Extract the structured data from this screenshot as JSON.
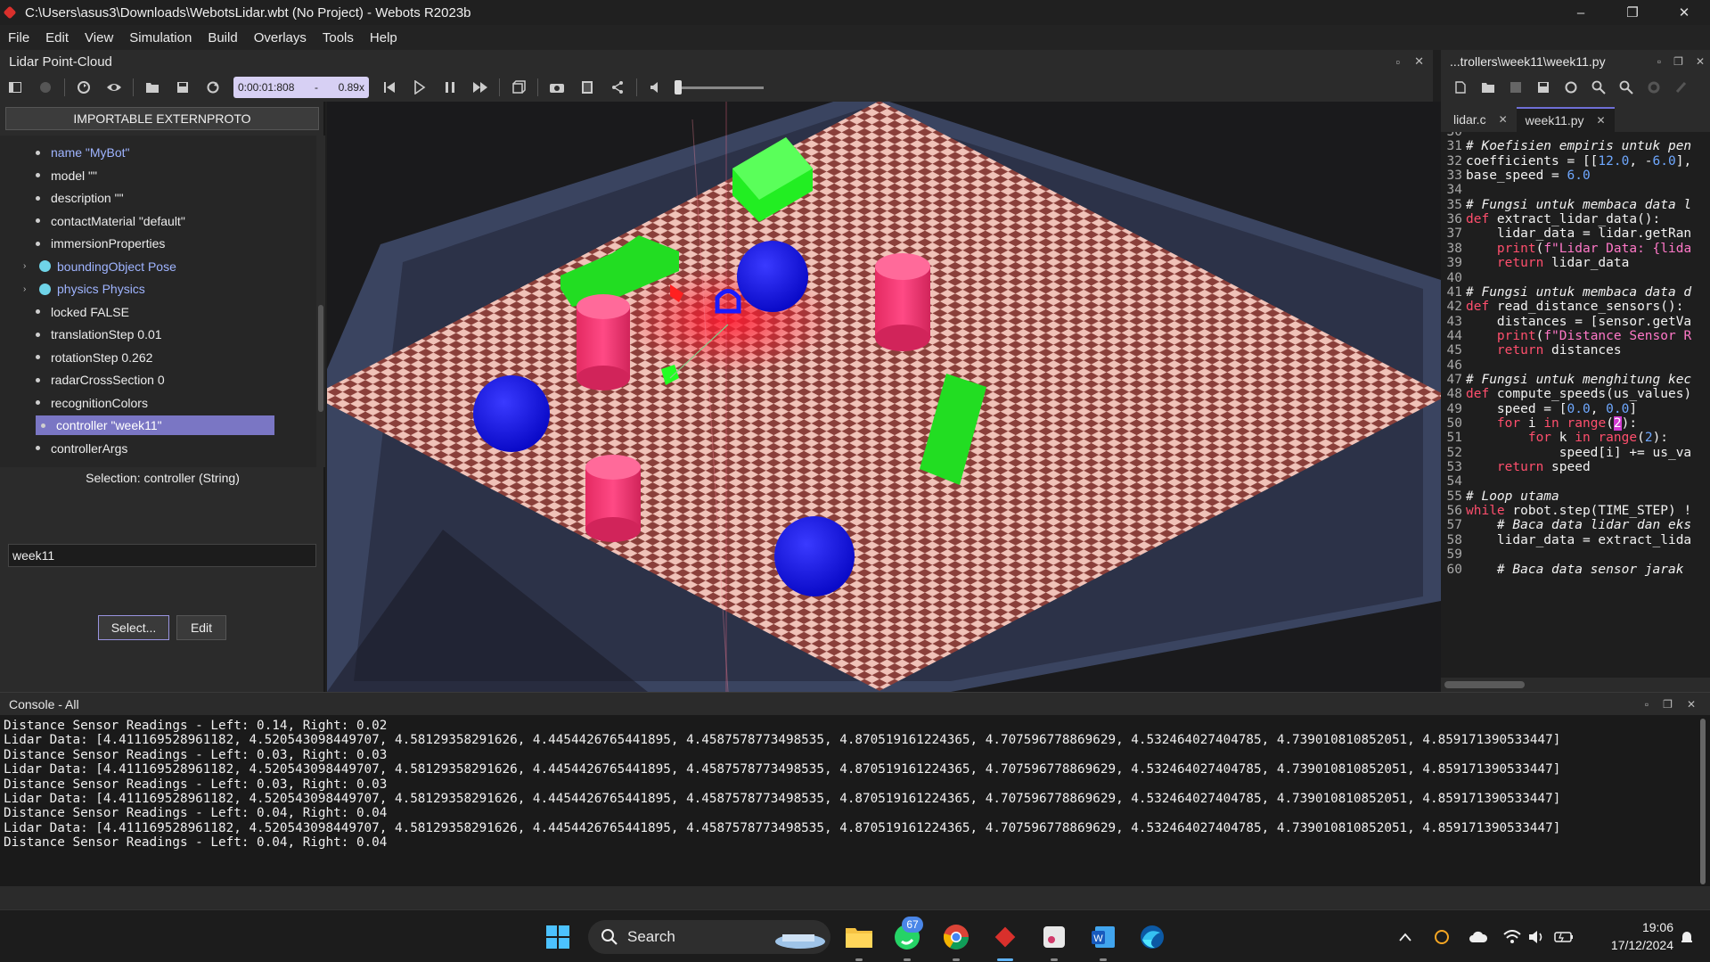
{
  "window": {
    "title": "C:\\Users\\asus3\\Downloads\\WebotsLidar.wbt (No Project) - Webots R2023b",
    "minimize": "–",
    "maximize": "❐",
    "close": "✕"
  },
  "menu": [
    "File",
    "Edit",
    "View",
    "Simulation",
    "Build",
    "Overlays",
    "Tools",
    "Help"
  ],
  "view_panel": {
    "title": "Lidar Point-Cloud",
    "clock": "0:00:01:808",
    "speed_sep": "-",
    "speed": "0.89x",
    "volume_level": 0.0
  },
  "scene_tree": {
    "proto_button": "IMPORTABLE EXTERNPROTO",
    "items": [
      {
        "label": "name \"MyBot\"",
        "kind": "field",
        "link": true
      },
      {
        "label": "model \"\"",
        "kind": "field"
      },
      {
        "label": "description \"\"",
        "kind": "field"
      },
      {
        "label": "contactMaterial \"default\"",
        "kind": "field"
      },
      {
        "label": "immersionProperties",
        "kind": "field"
      },
      {
        "label": "boundingObject Pose",
        "kind": "node",
        "link": true
      },
      {
        "label": "physics Physics",
        "kind": "node",
        "link": true
      },
      {
        "label": "locked FALSE",
        "kind": "field"
      },
      {
        "label": "translationStep 0.01",
        "kind": "field"
      },
      {
        "label": "rotationStep 0.262",
        "kind": "field"
      },
      {
        "label": "radarCrossSection 0",
        "kind": "field"
      },
      {
        "label": "recognitionColors",
        "kind": "field"
      },
      {
        "label": "controller \"week11\"",
        "kind": "field",
        "selected": true
      },
      {
        "label": "controllerArgs",
        "kind": "field"
      }
    ],
    "selection_label": "Selection: controller (String)",
    "field_value": "week11",
    "select_button": "Select...",
    "edit_button": "Edit"
  },
  "editor": {
    "title": "...trollers\\week11\\week11.py",
    "tabs": [
      {
        "label": "lidar.c",
        "active": false
      },
      {
        "label": "week11.py",
        "active": true
      }
    ],
    "lines": [
      {
        "n": "30",
        "text": ""
      },
      {
        "n": "31",
        "text": "# Koefisien empiris untuk pen",
        "style": "comment"
      },
      {
        "n": "32",
        "text": "coefficients = [[12.0, -6.0],"
      },
      {
        "n": "33",
        "text": "base_speed = 6.0"
      },
      {
        "n": "34",
        "text": ""
      },
      {
        "n": "35",
        "text": "# Fungsi untuk membaca data l",
        "style": "comment"
      },
      {
        "n": "36",
        "text": "def extract_lidar_data():"
      },
      {
        "n": "37",
        "text": "    lidar_data = lidar.getRan"
      },
      {
        "n": "38",
        "text": "    print(f\"Lidar Data: {lida"
      },
      {
        "n": "39",
        "text": "    return lidar_data"
      },
      {
        "n": "40",
        "text": ""
      },
      {
        "n": "41",
        "text": "# Fungsi untuk membaca data d",
        "style": "comment"
      },
      {
        "n": "42",
        "text": "def read_distance_sensors():"
      },
      {
        "n": "43",
        "text": "    distances = [sensor.getVa"
      },
      {
        "n": "44",
        "text": "    print(f\"Distance Sensor R"
      },
      {
        "n": "45",
        "text": "    return distances"
      },
      {
        "n": "46",
        "text": ""
      },
      {
        "n": "47",
        "text": "# Fungsi untuk menghitung kec",
        "style": "comment"
      },
      {
        "n": "48",
        "text": "def compute_speeds(us_values)"
      },
      {
        "n": "49",
        "text": "    speed = [0.0, 0.0]"
      },
      {
        "n": "50",
        "text": "    for i in range(2):"
      },
      {
        "n": "51",
        "text": "        for k in range(2):"
      },
      {
        "n": "52",
        "text": "            speed[i] += us_va"
      },
      {
        "n": "53",
        "text": "    return speed"
      },
      {
        "n": "54",
        "text": ""
      },
      {
        "n": "55",
        "text": "# Loop utama",
        "style": "comment"
      },
      {
        "n": "56",
        "text": "while robot.step(TIME_STEP) !"
      },
      {
        "n": "57",
        "text": "    # Baca data lidar dan eks",
        "style": "comment"
      },
      {
        "n": "58",
        "text": "    lidar_data = extract_lida"
      },
      {
        "n": "59",
        "text": ""
      },
      {
        "n": "60",
        "text": "    # Baca data sensor jarak",
        "style": "comment"
      }
    ]
  },
  "console": {
    "title": "Console - All",
    "lines": [
      "Distance Sensor Readings - Left: 0.14, Right: 0.02",
      "Lidar Data: [4.411169528961182, 4.520543098449707, 4.58129358291626, 4.4454426765441895, 4.4587578773498535, 4.870519161224365, 4.707596778869629, 4.532464027404785, 4.739010810852051, 4.859171390533447]",
      "Distance Sensor Readings - Left: 0.03, Right: 0.03",
      "Lidar Data: [4.411169528961182, 4.520543098449707, 4.58129358291626, 4.4454426765441895, 4.4587578773498535, 4.870519161224365, 4.707596778869629, 4.532464027404785, 4.739010810852051, 4.859171390533447]",
      "Distance Sensor Readings - Left: 0.03, Right: 0.03",
      "Lidar Data: [4.411169528961182, 4.520543098449707, 4.58129358291626, 4.4454426765441895, 4.4587578773498535, 4.870519161224365, 4.707596778869629, 4.532464027404785, 4.739010810852051, 4.859171390533447]",
      "Distance Sensor Readings - Left: 0.04, Right: 0.04",
      "Lidar Data: [4.411169528961182, 4.520543098449707, 4.58129358291626, 4.4454426765441895, 4.4587578773498535, 4.870519161224365, 4.707596778869629, 4.532464027404785, 4.739010810852051, 4.859171390533447]",
      "Distance Sensor Readings - Left: 0.04, Right: 0.04"
    ]
  },
  "taskbar": {
    "search_label": "Search",
    "whatsapp_badge": "67",
    "time": "19:06",
    "date": "17/12/2024"
  },
  "colors": {
    "accent": "#7a76c4",
    "obstacle_green": "#1fe020",
    "obstacle_pink": "#f0336f",
    "obstacle_blue": "#1515ee"
  }
}
